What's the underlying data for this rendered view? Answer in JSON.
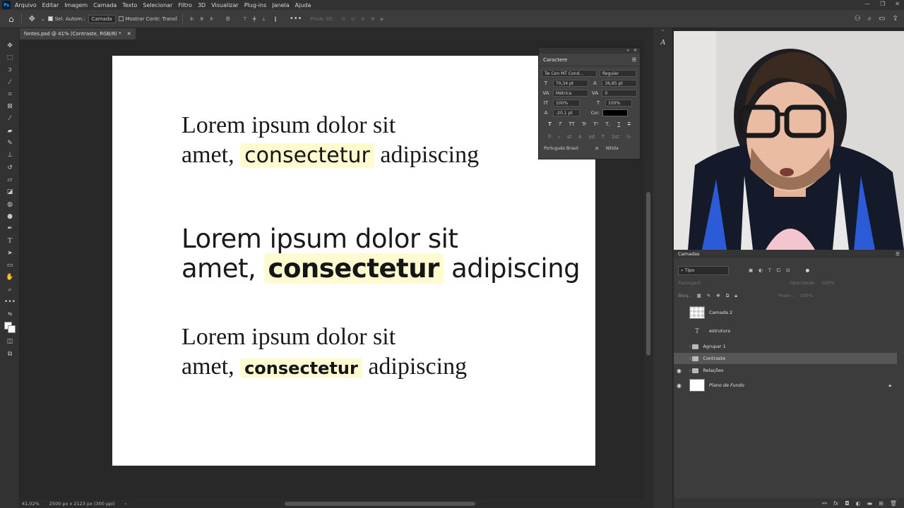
{
  "menubar": {
    "logo": "Ps",
    "items": [
      "Arquivo",
      "Editar",
      "Imagem",
      "Camada",
      "Texto",
      "Selecionar",
      "Filtro",
      "3D",
      "Visualizar",
      "Plug-ins",
      "Janela",
      "Ajuda"
    ]
  },
  "options": {
    "auto_select_label": "Sel. Autom.:",
    "auto_select_value": "Camada",
    "transform_label": "Mostrar Contr. Transf.",
    "mode_3d_label": "Modo 3D:"
  },
  "document": {
    "tab_title": "fontes.psd @ 41% (Contraste, RGB/8) *"
  },
  "canvas": {
    "block1": {
      "line1": "Lorem ipsum dolor sit",
      "pre": "amet, ",
      "highlight": "consectetur",
      "post": " adipiscing"
    },
    "block2": {
      "line1": "Lorem ipsum dolor sit",
      "pre": "amet, ",
      "highlight": "consectetur",
      "post": " adipiscing"
    },
    "block3": {
      "line1": "Lorem ipsum dolor sit",
      "pre": "amet, ",
      "highlight": "consectetur",
      "post": " adipiscing"
    },
    "highlight_color": "#fffbd0"
  },
  "status": {
    "zoom": "41,02%",
    "doc_size": "2500 px x 2123 px (300 ppi)"
  },
  "character_panel": {
    "title": "Caractere",
    "font_family": "Tw Cen MT Cond...",
    "font_style": "Regular",
    "font_size": "70,34 pt",
    "leading": "36,85 pt",
    "kerning": "Métrica",
    "tracking": "0",
    "vertical_scale": "100%",
    "horizontal_scale": "100%",
    "baseline_shift": "-20,1 pt",
    "color_label": "Cor:",
    "color": "#000000",
    "language": "Português Brasil",
    "aa_label": "a",
    "antialias": "Nítida",
    "style_buttons": [
      "T",
      "T",
      "TT",
      "Tr",
      "T¹",
      "T,",
      "T",
      "T"
    ]
  },
  "layers_panel": {
    "title": "Camadas",
    "filter_kind": "Tipo",
    "blend_mode": "Passagem",
    "opacity_label": "Opacidade:",
    "opacity": "100%",
    "lock_label": "Bloq.:",
    "fill_label": "Preen.:",
    "fill": "100%",
    "layers": [
      {
        "name": "Camada 2",
        "kind": "pixel",
        "visible": false
      },
      {
        "name": "estrutura",
        "kind": "text",
        "visible": false
      },
      {
        "name": "Agrupar 1",
        "kind": "group",
        "visible": false
      },
      {
        "name": "Contraste",
        "kind": "group",
        "visible": false,
        "selected": true
      },
      {
        "name": "Relações",
        "kind": "group",
        "visible": true
      },
      {
        "name": "Plano de Fundo",
        "kind": "background",
        "visible": true,
        "locked": true
      }
    ]
  }
}
